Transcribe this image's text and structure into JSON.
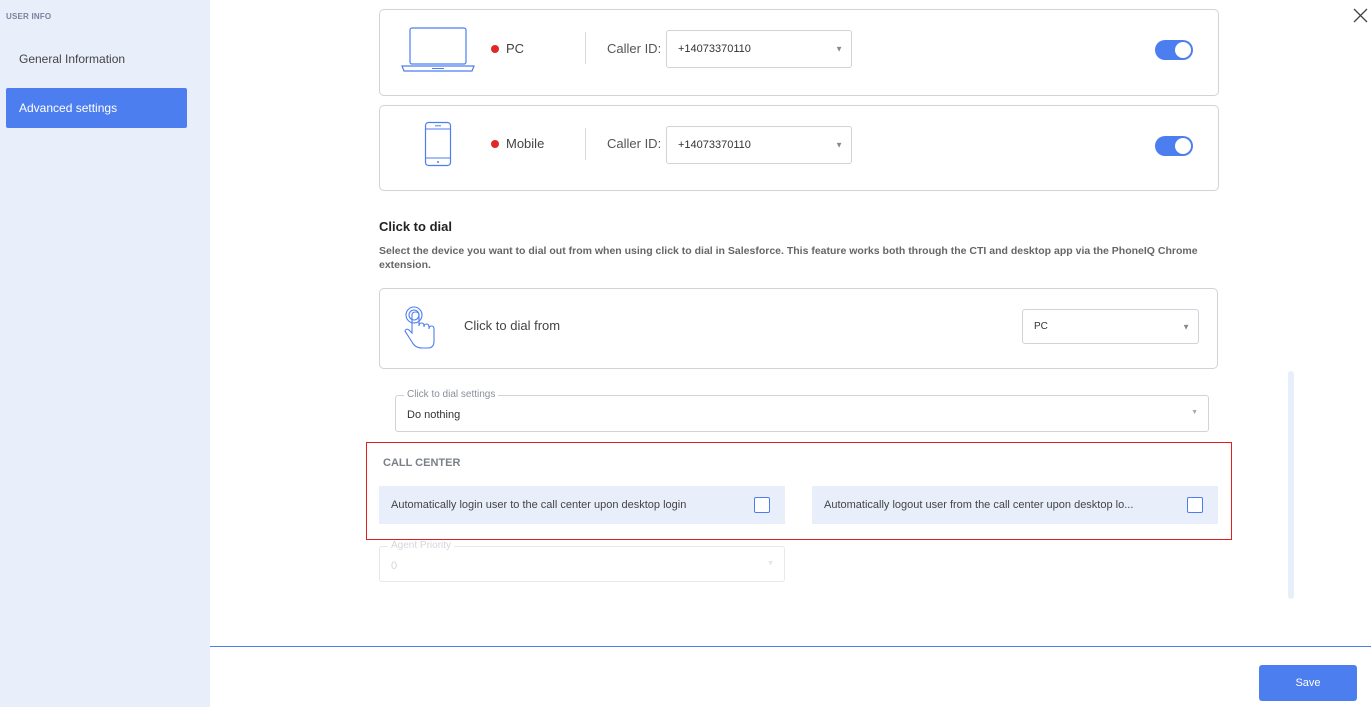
{
  "sidebar": {
    "title": "USER INFO",
    "items": [
      {
        "label": "General Information",
        "active": false
      },
      {
        "label": "Advanced settings",
        "active": true
      }
    ]
  },
  "devices": [
    {
      "name": "PC",
      "status_color": "#e02828",
      "caller_id_label": "Caller ID:",
      "caller_id": "+14073370110",
      "enabled": true
    },
    {
      "name": "Mobile",
      "status_color": "#e02828",
      "caller_id_label": "Caller ID:",
      "caller_id": "+14073370110",
      "enabled": true
    }
  ],
  "click_to_dial": {
    "heading": "Click to dial",
    "description": "Select the device you want to dial out from when using click to dial in Salesforce. This feature works both through the CTI and desktop app via the PhoneIQ Chrome extension.",
    "from_label": "Click to dial from",
    "from_value": "PC",
    "settings_legend": "Click to dial settings",
    "settings_value": "Do nothing"
  },
  "call_center": {
    "title": "CALL CENTER",
    "auto_login_label": "Automatically login user to the call center upon desktop login",
    "auto_login_checked": false,
    "auto_logout_label": "Automatically logout user from the call center upon desktop lo...",
    "auto_logout_checked": false
  },
  "agent_priority": {
    "legend": "Agent Priority",
    "value": "0"
  },
  "footer": {
    "save_label": "Save"
  },
  "colors": {
    "accent": "#4c7ef0",
    "sidebar_bg": "#e9eefb",
    "highlight": "#e02020",
    "status_offline": "#e02828"
  },
  "icons": {
    "close": "close-icon",
    "pc": "laptop-icon",
    "mobile": "mobile-phone-icon",
    "click_to_dial": "tap-finger-icon"
  }
}
